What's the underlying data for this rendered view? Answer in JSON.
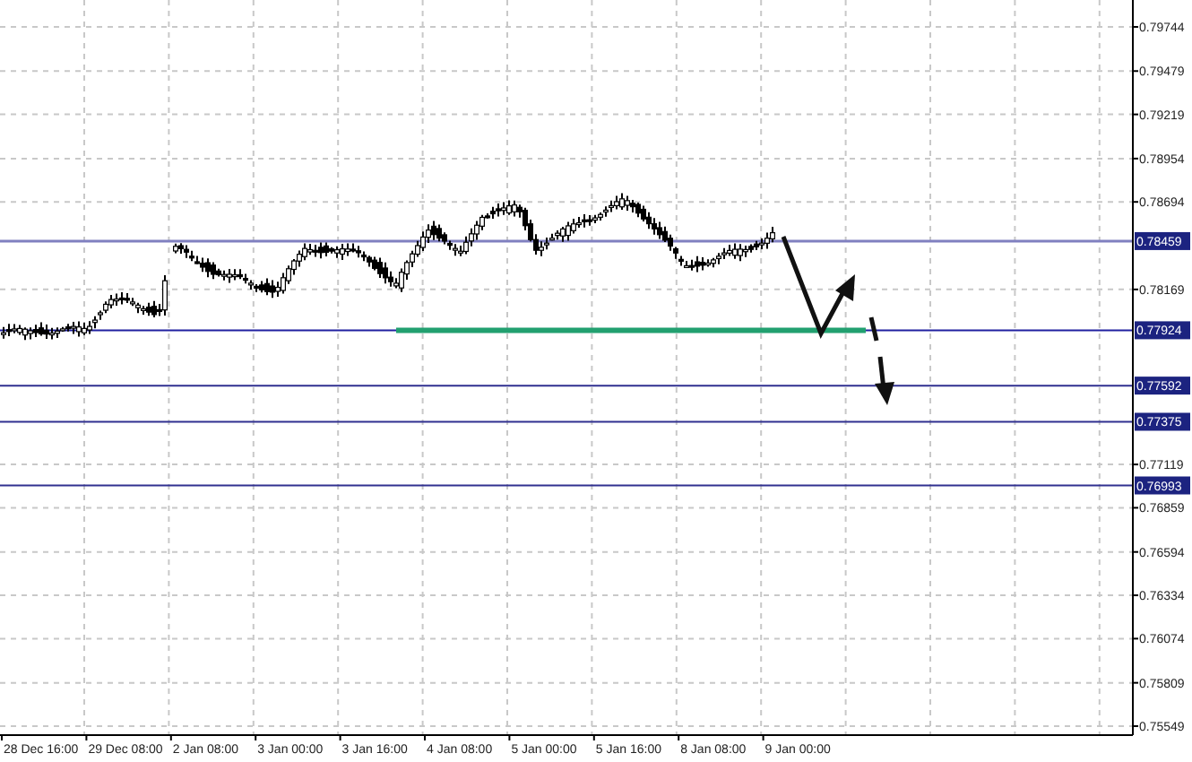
{
  "price_axis": {
    "ticks": [
      "0.79744",
      "0.79479",
      "0.79219",
      "0.78954",
      "0.78694",
      "0.78169",
      "0.77119",
      "0.76859",
      "0.76594",
      "0.76334",
      "0.76074",
      "0.75809",
      "0.75549"
    ]
  },
  "levels": [
    {
      "label": "0.78459",
      "kind": "resistance"
    },
    {
      "label": "0.77924",
      "kind": "support"
    },
    {
      "label": "0.77592",
      "kind": "target"
    },
    {
      "label": "0.77375",
      "kind": "target"
    },
    {
      "label": "0.76993",
      "kind": "target"
    }
  ],
  "time_axis": {
    "labels": [
      "28 Dec 16:00",
      "29 Dec 08:00",
      "2 Jan 08:00",
      "3 Jan 00:00",
      "3 Jan 16:00",
      "4 Jan 08:00",
      "5 Jan 00:00",
      "5 Jan 16:00",
      "8 Jan 08:00",
      "9 Jan 00:00"
    ]
  }
}
